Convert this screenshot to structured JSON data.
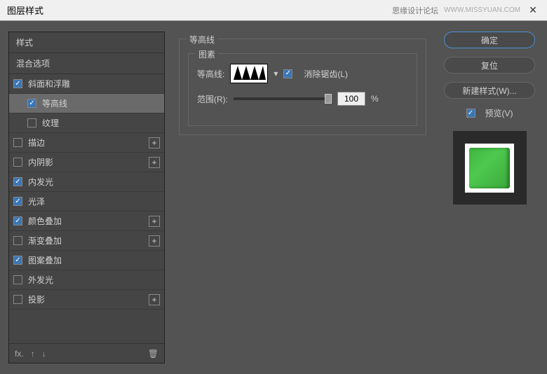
{
  "titlebar": {
    "title": "图层样式",
    "watermark": "思缘设计论坛",
    "url": "WWW.MISSYUAN.COM"
  },
  "sections": {
    "styles": "样式",
    "blend": "混合选项"
  },
  "items": {
    "bevel": "斜面和浮雕",
    "contour": "等高线",
    "texture": "纹理",
    "stroke": "描边",
    "innerShadow": "内阴影",
    "innerGlow": "内发光",
    "satin": "光泽",
    "colorOverlay": "颜色叠加",
    "gradientOverlay": "渐变叠加",
    "patternOverlay": "图案叠加",
    "outerGlow": "外发光",
    "dropShadow": "投影"
  },
  "center": {
    "groupTitle": "等高线",
    "elementsTitle": "图素",
    "contourLabel": "等高线:",
    "antialias": "消除锯齿(L)",
    "rangeLabel": "范围(R):",
    "rangeValue": "100",
    "percent": "%"
  },
  "buttons": {
    "ok": "确定",
    "reset": "复位",
    "newStyle": "新建样式(W)...",
    "preview": "预览(V)"
  },
  "footer": {
    "fx": "fx."
  }
}
